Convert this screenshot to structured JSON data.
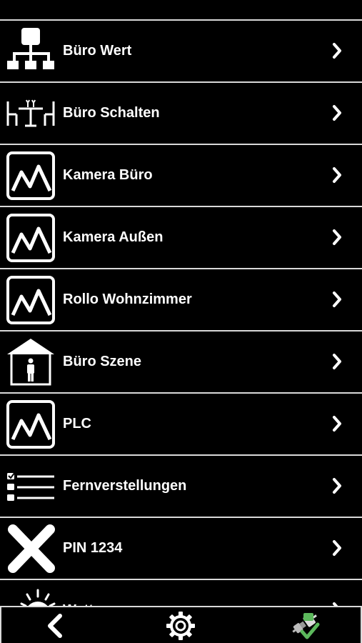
{
  "list": {
    "items": [
      {
        "label": "Büro Wert",
        "icon": "network-icon"
      },
      {
        "label": "Büro Schalten",
        "icon": "table-chairs-icon"
      },
      {
        "label": "Kamera Büro",
        "icon": "chart-icon"
      },
      {
        "label": "Kamera Außen",
        "icon": "chart-icon"
      },
      {
        "label": "Rollo Wohnzimmer",
        "icon": "chart-icon"
      },
      {
        "label": "Büro Szene",
        "icon": "house-person-icon"
      },
      {
        "label": "PLC",
        "icon": "chart-icon"
      },
      {
        "label": "Fernverstellungen",
        "icon": "checklist-icon"
      },
      {
        "label": "PIN 1234",
        "icon": "x-cross-icon"
      },
      {
        "label": "Wetter",
        "icon": "sun-icon"
      }
    ]
  },
  "bottom_bar": {
    "back": "back-arrow-icon",
    "settings": "gear-icon",
    "status": "connection-check-icon"
  },
  "colors": {
    "background": "#000000",
    "text": "#ffffff",
    "separator": "#d9d9d9",
    "check": "#5cb85c"
  }
}
